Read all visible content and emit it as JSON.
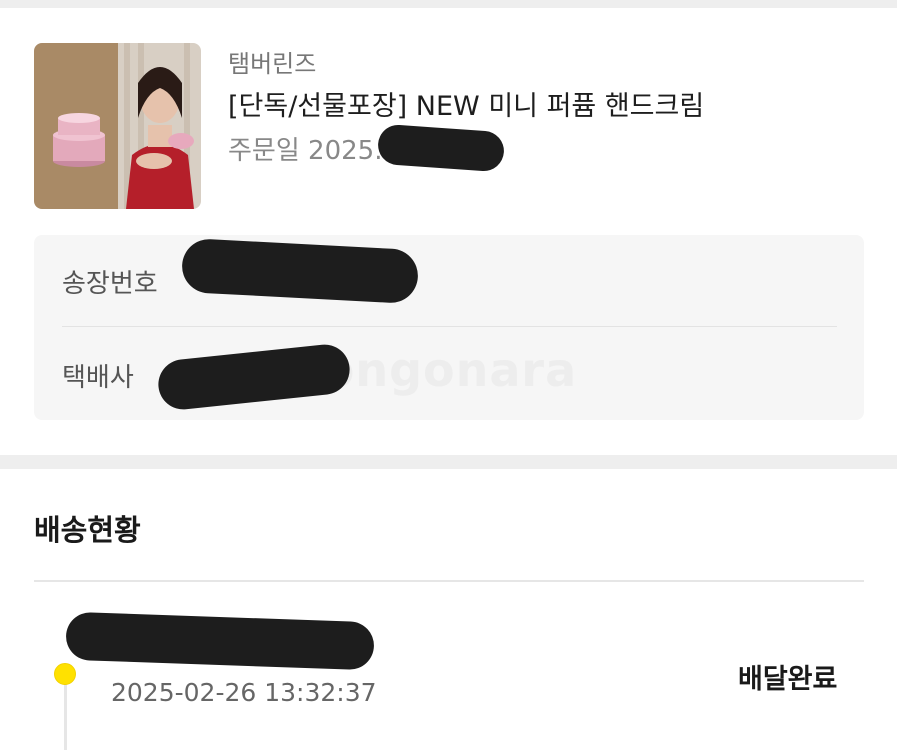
{
  "product": {
    "brand": "탬버린즈",
    "name": "[단독/선물포장] NEW 미니 퍼퓸 핸드크림",
    "order_date_label": "주문일 2025.",
    "image_icon": "product-photo-icon"
  },
  "shipping": {
    "invoice_label": "송장번호",
    "courier_label": "택배사",
    "watermark": "Joongonara"
  },
  "tracking": {
    "title": "배송현황",
    "events": [
      {
        "time": "2025-02-26 13:32:37",
        "status": "배달완료"
      }
    ]
  },
  "colors": {
    "accent_dot": "#ffe100",
    "section_gap": "#eeeeee",
    "info_bg": "#f6f6f6"
  }
}
